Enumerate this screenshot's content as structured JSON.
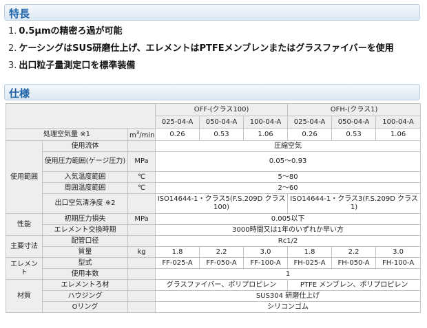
{
  "features": {
    "heading": "特長",
    "items": [
      {
        "num": "1.",
        "text": "0.5μmの精密ろ過が可能"
      },
      {
        "num": "2.",
        "text": "ケーシングはSUS研磨仕上げ、エレメントはPTFEメンブレンまたはグラスファイバーを使用"
      },
      {
        "num": "3.",
        "text": "出口粒子量測定口を標準装備"
      }
    ]
  },
  "specs": {
    "heading": "仕様",
    "group_off": "OFF-(クラス100)",
    "group_ofh": "OFH-(クラス1)",
    "models": [
      "025-04-A",
      "050-04-A",
      "100-04-A",
      "025-04-A",
      "050-04-A",
      "100-04-A"
    ],
    "air_flow": {
      "label": "処理空気量 ※1",
      "unit_pre": "m",
      "unit_sup": "3",
      "unit_post": "/min",
      "values": [
        "0.26",
        "0.53",
        "1.06",
        "0.26",
        "0.53",
        "1.06"
      ]
    },
    "usage": {
      "category": "使用範囲",
      "fluid": {
        "label": "使用流体",
        "value": "圧縮空気"
      },
      "pressure": {
        "label": "使用圧力範囲(ゲージ圧力)",
        "unit": "MPa",
        "value": "0.05～0.93"
      },
      "inlet_temp": {
        "label": "入気温度範囲",
        "unit": "℃",
        "value": "5～80"
      },
      "ambient_temp": {
        "label": "周囲温度範囲",
        "unit": "℃",
        "value": "2～60"
      }
    },
    "performance": {
      "category": "性能",
      "cleanliness": {
        "label": "出口空気清浄度 ※2",
        "off": "ISO14644-1・クラス5(F.S.209D クラス100)",
        "ofh": "ISO14644-1・クラス3(F.S.209D クラス1)"
      },
      "pressure_loss": {
        "label": "初期圧力損失",
        "unit": "MPa",
        "value": "0.005以下"
      },
      "replacement": {
        "label": "エレメント交換時期",
        "value": "3000時間又は1年のいずれか早い方"
      }
    },
    "dimensions": {
      "category": "主要寸法",
      "port": {
        "label": "配管口径",
        "value": "Rc1/2"
      },
      "mass": {
        "label": "質量",
        "unit": "kg",
        "values": [
          "1.8",
          "2.2",
          "3.0",
          "1.8",
          "2.2",
          "3.0"
        ]
      }
    },
    "element": {
      "category": "エレメント",
      "type": {
        "label": "型式",
        "values": [
          "FF-025-A",
          "FF-050-A",
          "FF-100-A",
          "FH-025-A",
          "FH-050-A",
          "FH-100-A"
        ]
      },
      "count": {
        "label": "使用本数",
        "value": "1"
      }
    },
    "material": {
      "category": "材質",
      "element_filter": {
        "label": "エレメントろ材",
        "off": "グラスファイバー、ポリプロピレン",
        "ofh": "PTFE メンブレン、ポリプロピレン"
      },
      "housing": {
        "label": "ハウジング",
        "value": "SUS304 研磨仕上げ"
      },
      "oring": {
        "label": "Oリング",
        "value": "シリコンゴム"
      }
    }
  }
}
